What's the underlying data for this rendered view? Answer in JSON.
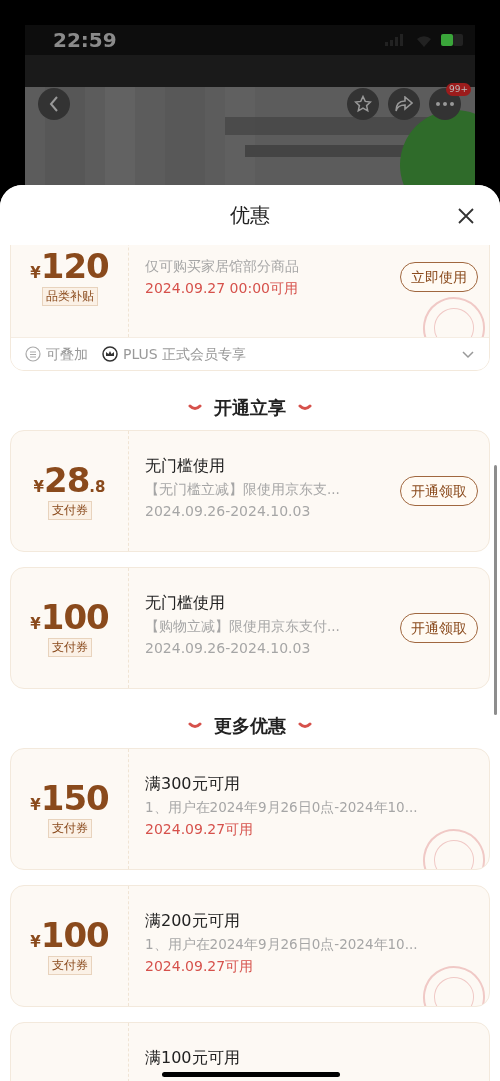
{
  "status_bar": {
    "time": "22:59"
  },
  "product_page": {
    "badge": "99+"
  },
  "sheet": {
    "title": "优惠",
    "sections": [
      {
        "coupons": [
          {
            "currency": "¥",
            "amount": "120",
            "tag": "品类补贴",
            "description": "仅可购买家居馆部分商品",
            "validity": "2024.09.27 00:00可用",
            "validity_alert": true,
            "button": "立即使用",
            "claimed": true,
            "footer": {
              "items": [
                {
                  "kind": "stack",
                  "label": "可叠加"
                },
                {
                  "kind": "plus",
                  "label": "PLUS 正式会员专享"
                }
              ],
              "expanded": false
            }
          }
        ]
      },
      {
        "title": "开通立享",
        "coupons": [
          {
            "currency": "¥",
            "amount": "28",
            "decimal": ".8",
            "tag": "支付券",
            "title": "无门槛使用",
            "description": "【无门槛立减】限使用京东支...",
            "validity": "2024.09.26-2024.10.03",
            "validity_alert": false,
            "button": "开通领取",
            "claimed": false
          },
          {
            "currency": "¥",
            "amount": "100",
            "tag": "支付券",
            "title": "无门槛使用",
            "description": "【购物立减】限使用京东支付...",
            "validity": "2024.09.26-2024.10.03",
            "validity_alert": false,
            "button": "开通领取",
            "claimed": false
          }
        ]
      },
      {
        "title": "更多优惠",
        "coupons": [
          {
            "currency": "¥",
            "amount": "150",
            "tag": "支付券",
            "title": "满300元可用",
            "description": "1、用户在2024年9月26日0点-2024年10...",
            "validity": "2024.09.27可用",
            "validity_alert": true,
            "claimed": true
          },
          {
            "currency": "¥",
            "amount": "100",
            "tag": "支付券",
            "title": "满200元可用",
            "description": "1、用户在2024年9月26日0点-2024年10...",
            "validity": "2024.09.27可用",
            "validity_alert": true,
            "claimed": true
          },
          {
            "title": "满100元可用",
            "claimed": false
          }
        ]
      }
    ]
  }
}
